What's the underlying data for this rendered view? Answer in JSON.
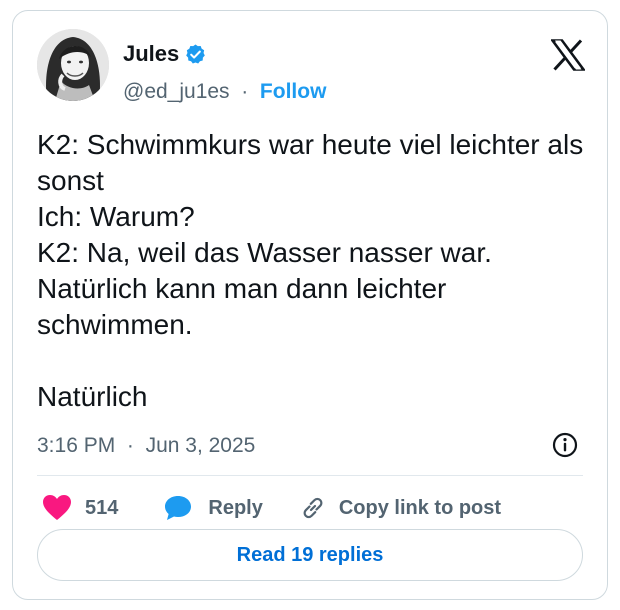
{
  "author": {
    "display_name": "Jules",
    "handle": "@ed_ju1es",
    "separator": "·",
    "follow_label": "Follow",
    "verified": true,
    "avatar_icon": "avatar-photo"
  },
  "platform_icon": "x-logo-icon",
  "tweet": {
    "text": "K2: Schwimmkurs war heute viel leichter als sonst\nIch: Warum?\nK2: Na, weil das Wasser nasser war. Natürlich kann man dann leichter schwimmen.\n\nNatürlich",
    "time": "3:16 PM",
    "meta_separator": "·",
    "date": "Jun 3, 2025"
  },
  "actions": {
    "like_count": "514",
    "reply_label": "Reply",
    "copy_label": "Copy link to post"
  },
  "read_replies_label": "Read 19 replies",
  "colors": {
    "accent": "#1d9bf0",
    "link": "#006fd6",
    "like": "#f91880",
    "text": "#0f1419",
    "muted": "#536471",
    "border": "#cfd9de"
  }
}
